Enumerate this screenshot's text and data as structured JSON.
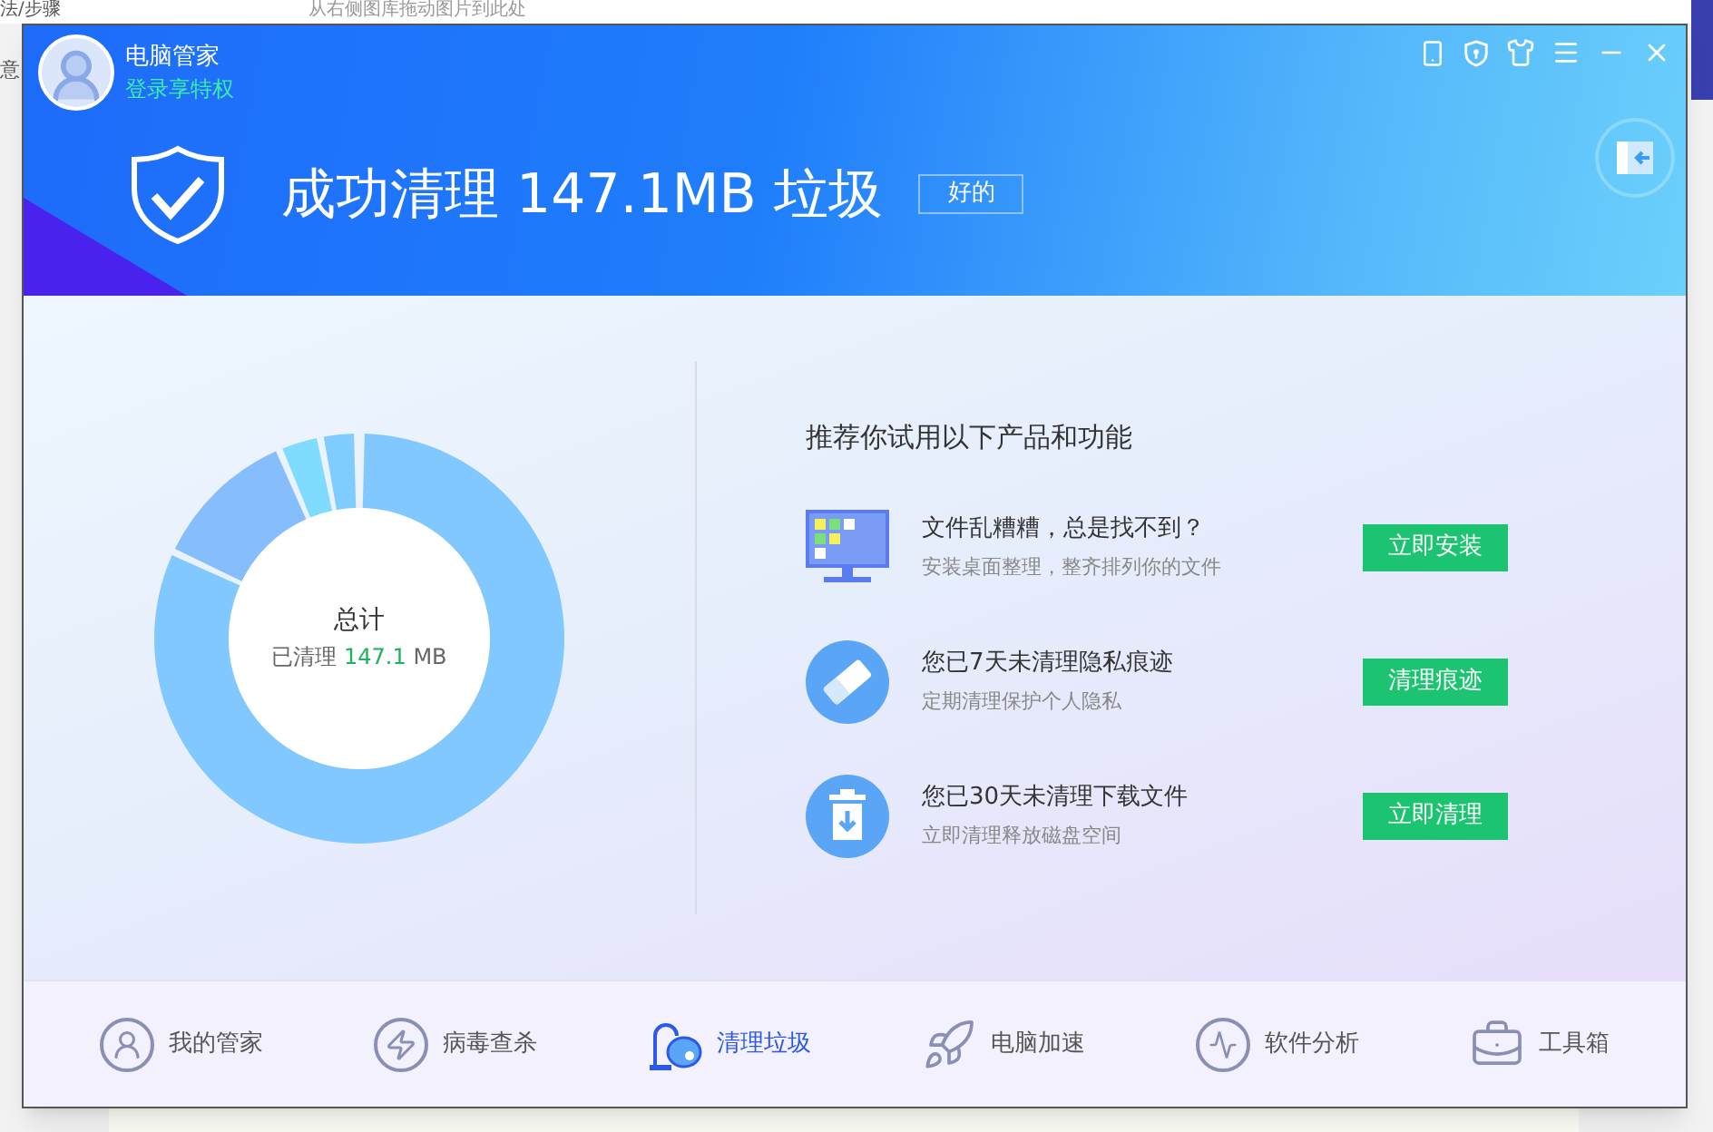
{
  "backdrop": {
    "top_text": "从右侧图库拖动图片到此处",
    "left_texts": [
      "法/步骤",
      "意"
    ]
  },
  "app": {
    "name": "电脑管家",
    "login": "登录享特权"
  },
  "result": {
    "headline": "成功清理 147.1MB 垃圾",
    "ok_button": "好的"
  },
  "summary": {
    "title": "总计",
    "label": "已清理",
    "amount": "147.1",
    "unit": "MB"
  },
  "recommend": {
    "title": "推荐你试用以下产品和功能",
    "items": [
      {
        "kind": "desktop",
        "title": "文件乱糟糟，总是找不到？",
        "desc": "安装桌面整理，整齐排列你的文件",
        "button": "立即安装"
      },
      {
        "kind": "eraser",
        "title": "您已7天未清理隐私痕迹",
        "desc": "定期清理保护个人隐私",
        "button": "清理痕迹"
      },
      {
        "kind": "trash",
        "title": "您已30天未清理下载文件",
        "desc": "立即清理释放磁盘空间",
        "button": "立即清理"
      }
    ]
  },
  "nav": [
    {
      "kind": "home",
      "label": "我的管家",
      "selected": false
    },
    {
      "kind": "virus",
      "label": "病毒查杀",
      "selected": false
    },
    {
      "kind": "clean",
      "label": "清理垃圾",
      "selected": true
    },
    {
      "kind": "speed",
      "label": "电脑加速",
      "selected": false
    },
    {
      "kind": "software",
      "label": "软件分析",
      "selected": false
    },
    {
      "kind": "tools",
      "label": "工具箱",
      "selected": false
    }
  ]
}
